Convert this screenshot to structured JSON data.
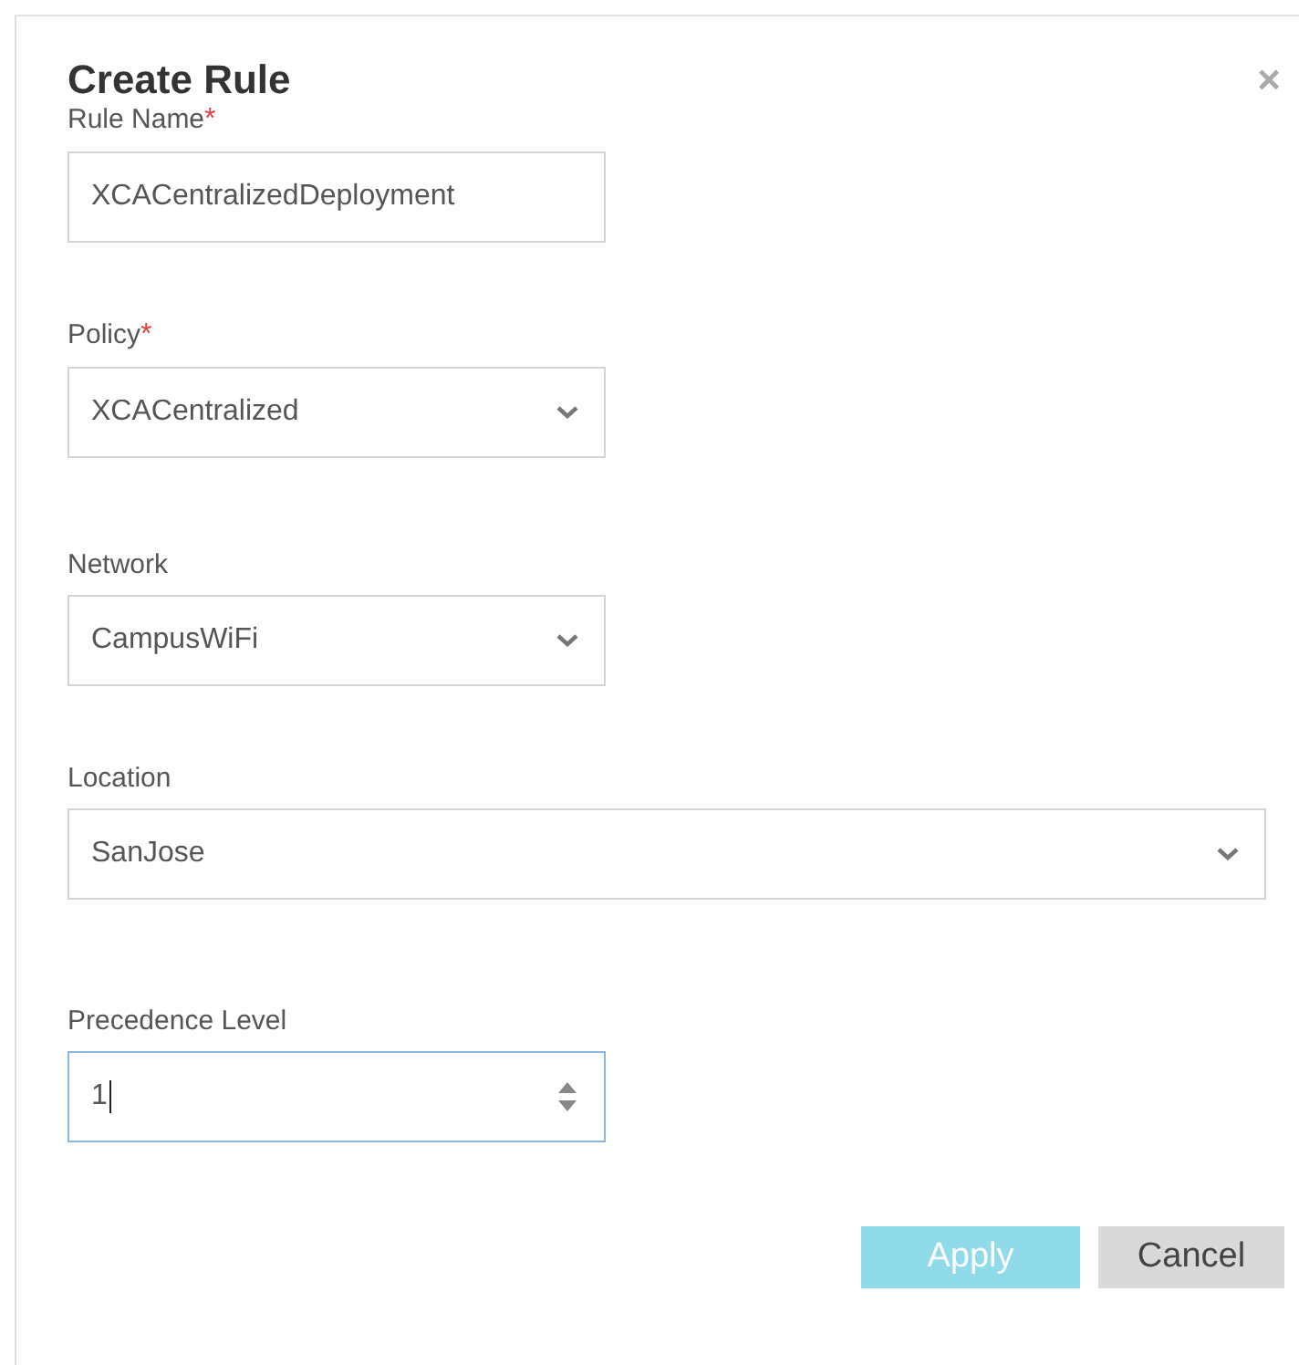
{
  "dialog": {
    "title": "Create Rule",
    "close": "×"
  },
  "fields": [
    {
      "kind": "text",
      "label": "Rule Name",
      "required_mark": "*",
      "value": "XCACentralizedDeployment",
      "wide": false,
      "focused": false
    },
    {
      "kind": "select",
      "label": "Policy",
      "required_mark": "*",
      "value": "XCACentralized",
      "wide": false,
      "focused": false
    },
    {
      "kind": "select",
      "label": "Network",
      "value": "CampusWiFi",
      "wide": false,
      "focused": false
    },
    {
      "kind": "select",
      "label": "Location",
      "value": "SanJose",
      "wide": true,
      "focused": false
    },
    {
      "kind": "number",
      "label": "Precedence Level",
      "value": "1",
      "wide": false,
      "focused": true
    }
  ],
  "buttons": [
    {
      "label": "Apply",
      "kind": "primary",
      "disabled": true
    },
    {
      "label": "Cancel",
      "kind": "secondary",
      "disabled": false
    }
  ]
}
